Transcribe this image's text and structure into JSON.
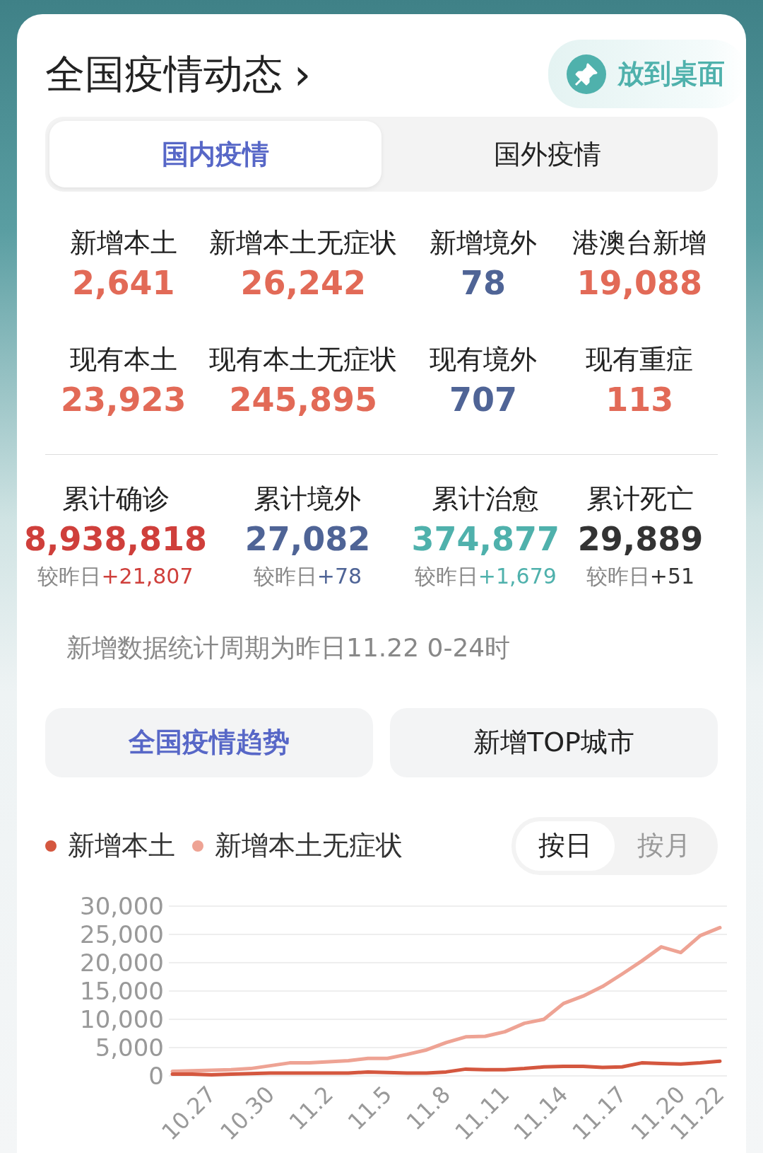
{
  "header": {
    "title": "全国疫情动态",
    "chevron": "›",
    "pin_button": "放到桌面"
  },
  "tabs": [
    {
      "label": "国内疫情",
      "selected": true
    },
    {
      "label": "国外疫情",
      "selected": false
    }
  ],
  "current_stats": [
    {
      "label": "新增本土",
      "value": "2,641",
      "color": "#e26a57"
    },
    {
      "label": "新增本土无症状",
      "value": "26,242",
      "color": "#e26a57"
    },
    {
      "label": "新增境外",
      "value": "78",
      "color": "#4f6496"
    },
    {
      "label": "港澳台新增",
      "value": "19,088",
      "color": "#e26a57"
    },
    {
      "label": "现有本土",
      "value": "23,923",
      "color": "#e26a57"
    },
    {
      "label": "现有本土无症状",
      "value": "245,895",
      "color": "#e26a57"
    },
    {
      "label": "现有境外",
      "value": "707",
      "color": "#4f6496"
    },
    {
      "label": "现有重症",
      "value": "113",
      "color": "#e26a57"
    }
  ],
  "cumulative_stats": [
    {
      "label": "累计确诊",
      "value": "8,938,818",
      "change_label": "较昨日",
      "change": "+21,807",
      "color": "#cf3f3b"
    },
    {
      "label": "累计境外",
      "value": "27,082",
      "change_label": "较昨日",
      "change": "+78",
      "color": "#4f6496"
    },
    {
      "label": "累计治愈",
      "value": "374,877",
      "change_label": "较昨日",
      "change": "+1,679",
      "color": "#4fb1ac"
    },
    {
      "label": "累计死亡",
      "value": "29,889",
      "change_label": "较昨日",
      "change": "+51",
      "color": "#333333"
    }
  ],
  "note": "新增数据统计周期为昨日11.22 0-24时",
  "sections": [
    {
      "label": "全国疫情趋势",
      "selected": true
    },
    {
      "label": "新增TOP城市",
      "selected": false
    }
  ],
  "period_toggle": [
    {
      "label": "按日",
      "selected": true
    },
    {
      "label": "按月",
      "selected": false
    }
  ],
  "chart_data": {
    "type": "line",
    "categories": [
      null,
      null,
      "10.27",
      null,
      null,
      "10.30",
      null,
      null,
      "11.2",
      null,
      null,
      "11.5",
      null,
      null,
      "11.8",
      null,
      null,
      "11.11",
      null,
      null,
      "11.14",
      null,
      null,
      "11.17",
      null,
      null,
      "11.20",
      null,
      "11.22"
    ],
    "grid": true,
    "series": [
      {
        "name": "新增本土",
        "color": "#d4573f",
        "values": [
          300,
          300,
          200,
          300,
          400,
          500,
          500,
          500,
          500,
          500,
          700,
          600,
          500,
          500,
          700,
          1200,
          1100,
          1100,
          1300,
          1600,
          1700,
          1700,
          1500,
          1600,
          2300,
          2200,
          2100,
          2300,
          2600
        ]
      },
      {
        "name": "新增本土无症状",
        "color": "#eea394",
        "values": [
          800,
          900,
          1000,
          1100,
          1300,
          1800,
          2300,
          2300,
          2500,
          2700,
          3100,
          3100,
          3800,
          4600,
          5900,
          6900,
          7000,
          7800,
          9300,
          10000,
          12800,
          14100,
          15800,
          18000,
          20300,
          22800,
          21800,
          24800,
          26200
        ]
      }
    ],
    "ylim": [
      0,
      30000
    ],
    "yticks": [
      {
        "value": 0,
        "label": "0"
      },
      {
        "value": 5000,
        "label": "5,000"
      },
      {
        "value": 10000,
        "label": "10,000"
      },
      {
        "value": 15000,
        "label": "15,000"
      },
      {
        "value": 20000,
        "label": "20,000"
      },
      {
        "value": 25000,
        "label": "25,000"
      },
      {
        "value": 30000,
        "label": "30,000"
      }
    ]
  }
}
